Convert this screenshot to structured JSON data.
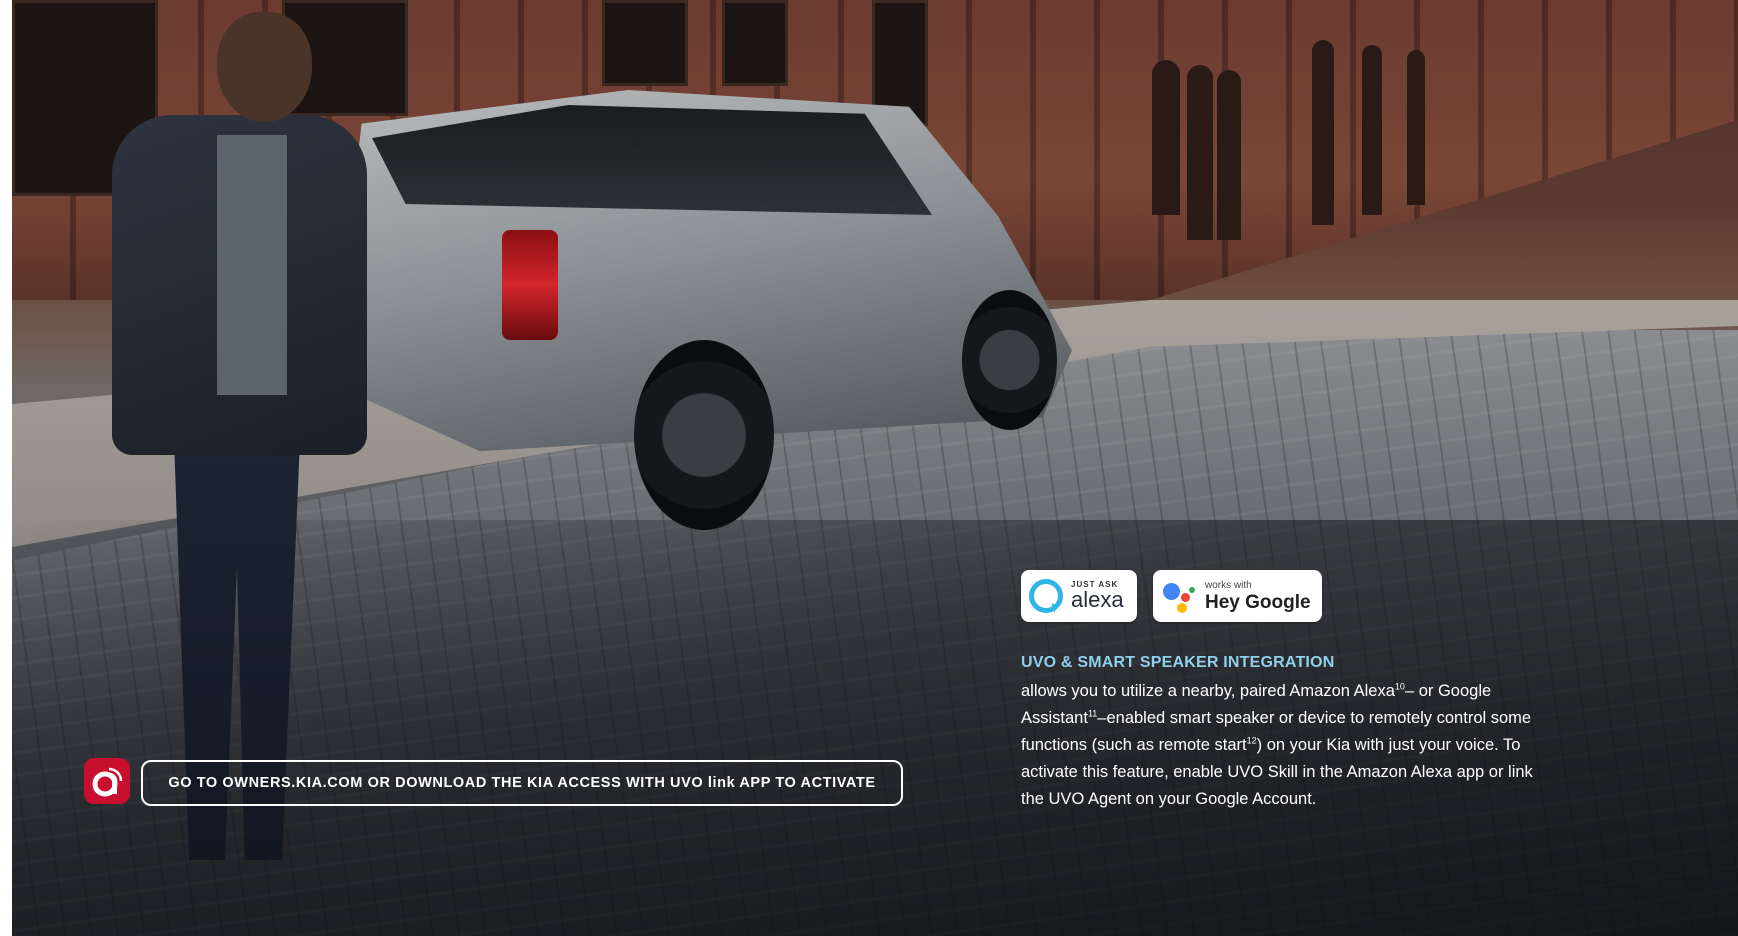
{
  "colors": {
    "kia_red": "#c8102e",
    "feature_title": "#8fd0ea",
    "alexa_blue": "#2fb6e6",
    "google_blue": "#4285f4",
    "google_red": "#ea4335",
    "google_yellow": "#fbbc04",
    "google_green": "#34a853"
  },
  "icons": {
    "app": "kia-access-app-icon",
    "alexa": "alexa-ring-logo",
    "google": "google-assistant-dots-logo"
  },
  "badges": {
    "alexa": {
      "small": "JUST ASK",
      "big": "alexa"
    },
    "google": {
      "small": "works with",
      "big": "Hey Google"
    }
  },
  "feature": {
    "title": "UVO & SMART SPEAKER INTEGRATION",
    "body_parts": [
      "allows you to utilize a nearby, paired Amazon Alexa",
      "10",
      "– or Google Assistant",
      "11",
      "–enabled smart speaker or device to remotely control some functions (such as remote start",
      "12",
      ") on your Kia with just your voice. To activate this feature, enable UVO Skill in the Amazon Alexa app or link the UVO Agent on your Google Account."
    ]
  },
  "cta": {
    "text": "GO TO OWNERS.KIA.COM OR DOWNLOAD THE KIA ACCESS WITH UVO link APP TO ACTIVATE"
  }
}
